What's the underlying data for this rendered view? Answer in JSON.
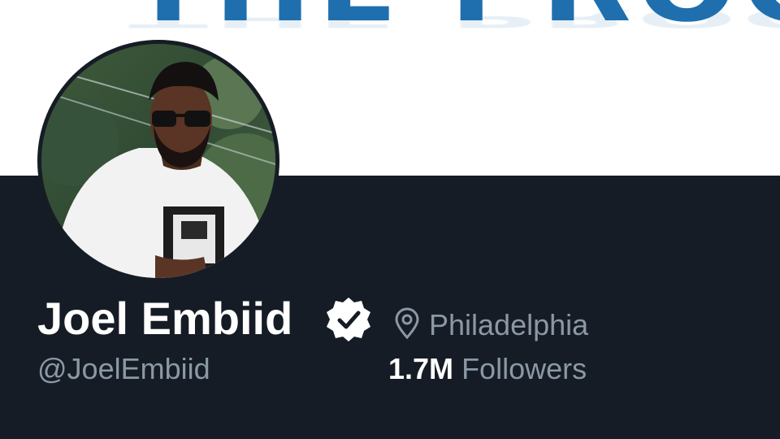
{
  "banner": {
    "text": "THE PROCE"
  },
  "profile": {
    "display_name": "Joel Embiid",
    "handle": "@JoelEmbiid",
    "location": "Philadelphia",
    "followers_count": "1.7M",
    "followers_label": "Followers",
    "verified": true
  },
  "icons": {
    "verified": "verified-badge-icon",
    "location": "location-pin-icon"
  },
  "colors": {
    "panel_bg": "#161c25",
    "banner_text": "#1f6fae",
    "muted_text": "#8b98a5",
    "primary_text": "#ffffff"
  }
}
